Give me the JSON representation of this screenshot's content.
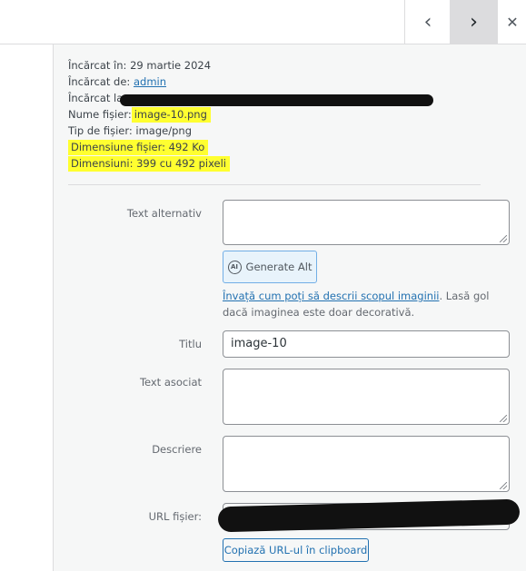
{
  "nav": {
    "prev_icon": "chevron-left-icon",
    "next_icon": "chevron-right-icon",
    "close_icon": "close-icon",
    "prev_glyph": "‹",
    "next_glyph": "›",
    "close_glyph": "✕"
  },
  "details": {
    "uploaded_on": "Încărcat în: 29 martie 2024",
    "uploaded_by_label": "Încărcat de:",
    "uploaded_by_user": "admin",
    "uploaded_to_label": "Încărcat la",
    "file_name_label": "Nume fișier:",
    "file_name_value": "image-10.png",
    "file_type": "Tip de fișier: image/png",
    "file_size": "Dimensiune fișier: 492 Ko",
    "dimensions": "Dimensiuni: 399 cu 492 pixeli"
  },
  "highlight_color": "#ffff30",
  "form": {
    "alt_label": "Text alternativ",
    "alt_value": "",
    "generate_alt_label": "Generate Alt",
    "generate_alt_icon": "ai-icon",
    "generate_alt_icon_text": "AI",
    "help_link": "Învață cum poți să descrii scopul imaginii",
    "help_rest": ". Lasă gol dacă imaginea este doar decorativă.",
    "title_label": "Titlu",
    "title_value": "image-10",
    "caption_label": "Text asociat",
    "caption_value": "",
    "description_label": "Descriere",
    "description_value": "",
    "url_label": "URL fișier:",
    "copy_url_label": "Copiază URL-ul în clipboard"
  }
}
